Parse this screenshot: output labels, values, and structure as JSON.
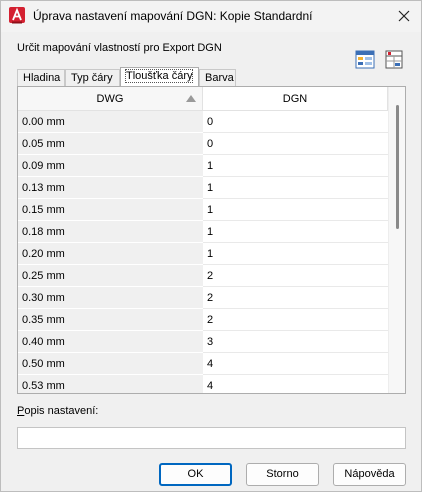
{
  "window": {
    "title": "Úprava nastavení mapování DGN: Kopie Standardní"
  },
  "instructions": "Určit mapování vlastností pro Export DGN",
  "tabs": [
    {
      "label": "Hladina",
      "active": false
    },
    {
      "label": "Typ čáry",
      "active": false
    },
    {
      "label": "Tloušťka čáry",
      "active": true
    },
    {
      "label": "Barva",
      "active": false
    }
  ],
  "grid": {
    "columns": {
      "dwg": "DWG",
      "dgn": "DGN"
    },
    "sort": "ascending",
    "rows": [
      {
        "dwg": "0.00 mm",
        "dgn": "0"
      },
      {
        "dwg": "0.05 mm",
        "dgn": "0"
      },
      {
        "dwg": "0.09 mm",
        "dgn": "1"
      },
      {
        "dwg": "0.13 mm",
        "dgn": "1"
      },
      {
        "dwg": "0.15 mm",
        "dgn": "1"
      },
      {
        "dwg": "0.18 mm",
        "dgn": "1"
      },
      {
        "dwg": "0.20 mm",
        "dgn": "1"
      },
      {
        "dwg": "0.25 mm",
        "dgn": "2"
      },
      {
        "dwg": "0.30 mm",
        "dgn": "2"
      },
      {
        "dwg": "0.35 mm",
        "dgn": "2"
      },
      {
        "dwg": "0.40 mm",
        "dgn": "3"
      },
      {
        "dwg": "0.50 mm",
        "dgn": "4"
      },
      {
        "dwg": "0.53 mm",
        "dgn": "4"
      }
    ]
  },
  "description": {
    "label_hotkey": "P",
    "label_rest": "opis nastavení:",
    "value": ""
  },
  "buttons": {
    "ok": "OK",
    "cancel": "Storno",
    "help": "Nápověda"
  },
  "colors": {
    "accent": "#0067c0",
    "app_icon": "#d42131"
  },
  "icons": [
    "autocad-app-icon",
    "close-icon",
    "sort-ascending-icon",
    "table-settings-icon",
    "table-export-icon"
  ]
}
